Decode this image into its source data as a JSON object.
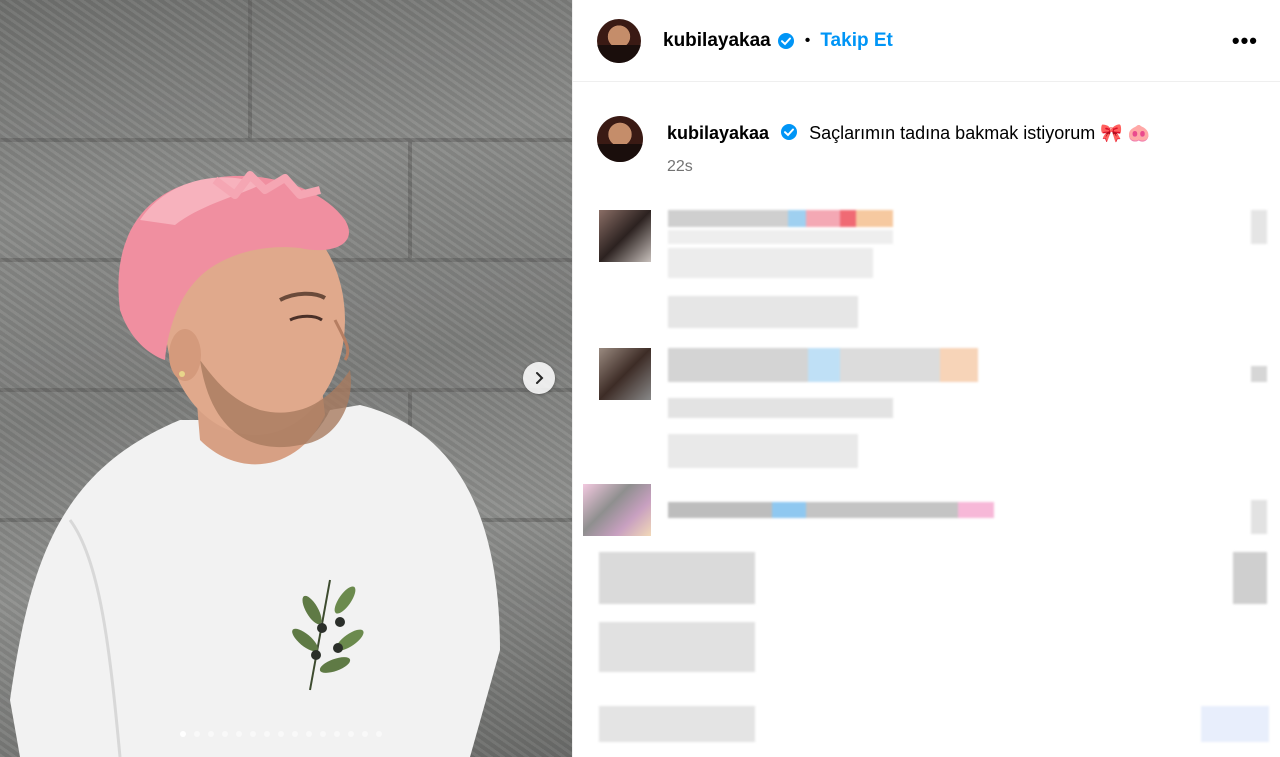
{
  "post": {
    "author": "kubilayakaa",
    "verified": true,
    "separator": "•",
    "follow_label": "Takip Et",
    "more_label": "•••",
    "caption_text": "Saçlarımın tadına bakmak istiyorum 🎀 🐽",
    "time_ago": "22s"
  },
  "media": {
    "slide_count": 15,
    "active_slide": 1,
    "next_icon": "chevron-right-icon"
  },
  "colors": {
    "accent": "#0095f6",
    "verified": "#0095f6"
  }
}
